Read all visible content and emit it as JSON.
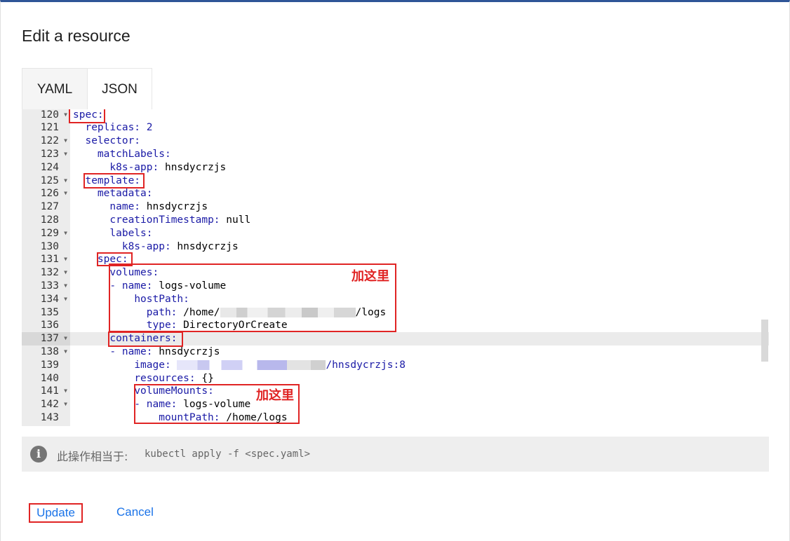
{
  "dialog": {
    "title": "Edit a resource",
    "tabs": [
      {
        "label": "YAML"
      },
      {
        "label": "JSON"
      }
    ],
    "active_tab": "JSON"
  },
  "editor": {
    "lines": [
      {
        "n": "120",
        "fold": true,
        "indent": 0,
        "key": "spec:",
        "val": ""
      },
      {
        "n": "121",
        "fold": false,
        "indent": 1,
        "key": "replicas:",
        "val": " 2",
        "valtype": "num"
      },
      {
        "n": "122",
        "fold": true,
        "indent": 1,
        "key": "selector:",
        "val": ""
      },
      {
        "n": "123",
        "fold": true,
        "indent": 2,
        "key": "matchLabels:",
        "val": ""
      },
      {
        "n": "124",
        "fold": false,
        "indent": 3,
        "key": "k8s-app:",
        "val": " hnsdycrzjs"
      },
      {
        "n": "125",
        "fold": true,
        "indent": 1,
        "key": "template:",
        "val": ""
      },
      {
        "n": "126",
        "fold": true,
        "indent": 2,
        "key": "metadata:",
        "val": ""
      },
      {
        "n": "127",
        "fold": false,
        "indent": 3,
        "key": "name:",
        "val": " hnsdycrzjs"
      },
      {
        "n": "128",
        "fold": false,
        "indent": 3,
        "key": "creationTimestamp:",
        "val": " null"
      },
      {
        "n": "129",
        "fold": true,
        "indent": 3,
        "key": "labels:",
        "val": ""
      },
      {
        "n": "130",
        "fold": false,
        "indent": 4,
        "key": "k8s-app:",
        "val": " hnsdycrzjs"
      },
      {
        "n": "131",
        "fold": true,
        "indent": 2,
        "key": "spec:",
        "val": ""
      },
      {
        "n": "132",
        "fold": true,
        "indent": 3,
        "key": "volumes:",
        "val": ""
      },
      {
        "n": "133",
        "fold": true,
        "indent": 4,
        "dash": true,
        "key": "name:",
        "val": " logs-volume"
      },
      {
        "n": "134",
        "fold": true,
        "indent": 5,
        "key": "hostPath:",
        "val": ""
      },
      {
        "n": "135",
        "fold": false,
        "indent": 6,
        "key": "path:",
        "val": " /home/",
        "blur": "b1",
        "after": "/logs"
      },
      {
        "n": "136",
        "fold": false,
        "indent": 6,
        "key": "type:",
        "val": " DirectoryOrCreate"
      },
      {
        "n": "137",
        "fold": true,
        "indent": 3,
        "key": "containers:",
        "val": "",
        "active": true
      },
      {
        "n": "138",
        "fold": true,
        "indent": 4,
        "dash": true,
        "key": "name:",
        "val": " hnsdycrzjs"
      },
      {
        "n": "139",
        "fold": false,
        "indent": 5,
        "key": "image:",
        "val": " ",
        "blur": "b2",
        "after": "/hnsdycrzjs:8"
      },
      {
        "n": "140",
        "fold": false,
        "indent": 5,
        "key": "resources:",
        "val": " {}"
      },
      {
        "n": "141",
        "fold": true,
        "indent": 5,
        "key": "volumeMounts:",
        "val": ""
      },
      {
        "n": "142",
        "fold": true,
        "indent": 6,
        "dash": true,
        "key": "name:",
        "val": " logs-volume"
      },
      {
        "n": "143",
        "fold": false,
        "indent": 7,
        "key": "mountPath:",
        "val": " /home/logs"
      }
    ]
  },
  "annotations": [
    {
      "text": "加这里"
    },
    {
      "text": "加这里"
    }
  ],
  "info": {
    "label": "此操作相当于:",
    "command": "kubectl apply -f <spec.yaml>"
  },
  "actions": {
    "update_label": "Update",
    "cancel_label": "Cancel"
  },
  "colors": {
    "accent": "#1a73e8",
    "highlight": "#e02424",
    "yaml_key": "#1a1aa6"
  }
}
